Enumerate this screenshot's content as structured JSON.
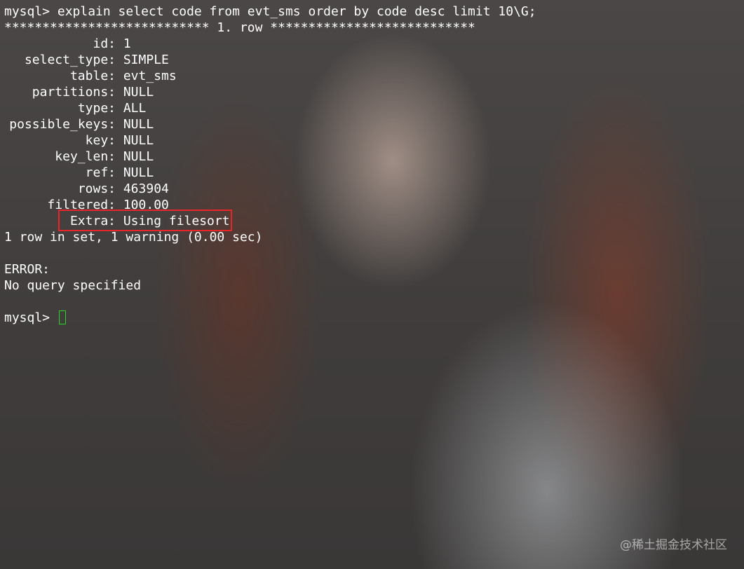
{
  "command_line": "mysql> explain select code from evt_sms order by code desc limit 10\\G;",
  "row_separator": "*************************** 1. row ***************************",
  "explain_rows": [
    {
      "label": "id:",
      "value": "1"
    },
    {
      "label": "select_type:",
      "value": "SIMPLE"
    },
    {
      "label": "table:",
      "value": "evt_sms"
    },
    {
      "label": "partitions:",
      "value": "NULL"
    },
    {
      "label": "type:",
      "value": "ALL"
    },
    {
      "label": "possible_keys:",
      "value": "NULL"
    },
    {
      "label": "key:",
      "value": "NULL"
    },
    {
      "label": "key_len:",
      "value": "NULL"
    },
    {
      "label": "ref:",
      "value": "NULL"
    },
    {
      "label": "rows:",
      "value": "463904"
    },
    {
      "label": "filtered:",
      "value": "100.00"
    },
    {
      "label": "Extra:",
      "value": "Using filesort"
    }
  ],
  "summary_line": "1 row in set, 1 warning (0.00 sec)",
  "error_label": "ERROR:",
  "error_message": "No query specified",
  "prompt": "mysql>",
  "watermark": "@稀土掘金技术社区",
  "colors": {
    "highlight_border": "#e8262a",
    "cursor": "#2bd52b",
    "text": "#ffffff"
  }
}
